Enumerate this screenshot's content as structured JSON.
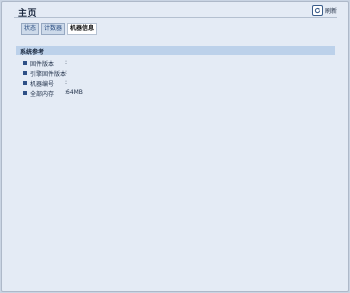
{
  "page": {
    "title": "主页",
    "refresh_label": "刷新"
  },
  "tabs": [
    {
      "label": "状态",
      "active": false
    },
    {
      "label": "计数器",
      "active": false
    },
    {
      "label": "机器信息",
      "active": true
    }
  ],
  "section": {
    "title": "系统参考"
  },
  "rows": [
    {
      "label": "固件版本",
      "colon": ":",
      "value": ""
    },
    {
      "label": "引擎固件版本",
      "colon": ":",
      "value": ""
    },
    {
      "label": "机器编号",
      "colon": ":",
      "value": ""
    },
    {
      "label": "全部内存",
      "colon": ":",
      "value": "64MB"
    }
  ],
  "colors": {
    "background": "#c9d4e3",
    "panel": "#e4ebf5",
    "section_bar": "#bcd1ea",
    "bullet": "#2d4f86"
  },
  "icons": {
    "refresh": "refresh-icon",
    "bullet": "square-bullet-icon"
  }
}
